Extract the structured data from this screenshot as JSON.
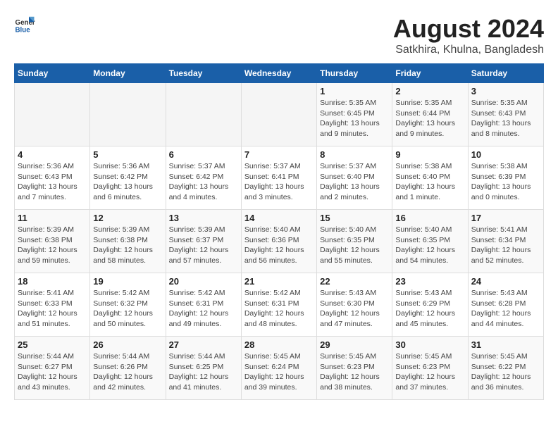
{
  "header": {
    "logo_general": "General",
    "logo_blue": "Blue",
    "title": "August 2024",
    "subtitle": "Satkhira, Khulna, Bangladesh"
  },
  "calendar": {
    "days_of_week": [
      "Sunday",
      "Monday",
      "Tuesday",
      "Wednesday",
      "Thursday",
      "Friday",
      "Saturday"
    ],
    "weeks": [
      [
        {
          "day": "",
          "info": ""
        },
        {
          "day": "",
          "info": ""
        },
        {
          "day": "",
          "info": ""
        },
        {
          "day": "",
          "info": ""
        },
        {
          "day": "1",
          "info": "Sunrise: 5:35 AM\nSunset: 6:45 PM\nDaylight: 13 hours\nand 9 minutes."
        },
        {
          "day": "2",
          "info": "Sunrise: 5:35 AM\nSunset: 6:44 PM\nDaylight: 13 hours\nand 9 minutes."
        },
        {
          "day": "3",
          "info": "Sunrise: 5:35 AM\nSunset: 6:43 PM\nDaylight: 13 hours\nand 8 minutes."
        }
      ],
      [
        {
          "day": "4",
          "info": "Sunrise: 5:36 AM\nSunset: 6:43 PM\nDaylight: 13 hours\nand 7 minutes."
        },
        {
          "day": "5",
          "info": "Sunrise: 5:36 AM\nSunset: 6:42 PM\nDaylight: 13 hours\nand 6 minutes."
        },
        {
          "day": "6",
          "info": "Sunrise: 5:37 AM\nSunset: 6:42 PM\nDaylight: 13 hours\nand 4 minutes."
        },
        {
          "day": "7",
          "info": "Sunrise: 5:37 AM\nSunset: 6:41 PM\nDaylight: 13 hours\nand 3 minutes."
        },
        {
          "day": "8",
          "info": "Sunrise: 5:37 AM\nSunset: 6:40 PM\nDaylight: 13 hours\nand 2 minutes."
        },
        {
          "day": "9",
          "info": "Sunrise: 5:38 AM\nSunset: 6:40 PM\nDaylight: 13 hours\nand 1 minute."
        },
        {
          "day": "10",
          "info": "Sunrise: 5:38 AM\nSunset: 6:39 PM\nDaylight: 13 hours\nand 0 minutes."
        }
      ],
      [
        {
          "day": "11",
          "info": "Sunrise: 5:39 AM\nSunset: 6:38 PM\nDaylight: 12 hours\nand 59 minutes."
        },
        {
          "day": "12",
          "info": "Sunrise: 5:39 AM\nSunset: 6:38 PM\nDaylight: 12 hours\nand 58 minutes."
        },
        {
          "day": "13",
          "info": "Sunrise: 5:39 AM\nSunset: 6:37 PM\nDaylight: 12 hours\nand 57 minutes."
        },
        {
          "day": "14",
          "info": "Sunrise: 5:40 AM\nSunset: 6:36 PM\nDaylight: 12 hours\nand 56 minutes."
        },
        {
          "day": "15",
          "info": "Sunrise: 5:40 AM\nSunset: 6:35 PM\nDaylight: 12 hours\nand 55 minutes."
        },
        {
          "day": "16",
          "info": "Sunrise: 5:40 AM\nSunset: 6:35 PM\nDaylight: 12 hours\nand 54 minutes."
        },
        {
          "day": "17",
          "info": "Sunrise: 5:41 AM\nSunset: 6:34 PM\nDaylight: 12 hours\nand 52 minutes."
        }
      ],
      [
        {
          "day": "18",
          "info": "Sunrise: 5:41 AM\nSunset: 6:33 PM\nDaylight: 12 hours\nand 51 minutes."
        },
        {
          "day": "19",
          "info": "Sunrise: 5:42 AM\nSunset: 6:32 PM\nDaylight: 12 hours\nand 50 minutes."
        },
        {
          "day": "20",
          "info": "Sunrise: 5:42 AM\nSunset: 6:31 PM\nDaylight: 12 hours\nand 49 minutes."
        },
        {
          "day": "21",
          "info": "Sunrise: 5:42 AM\nSunset: 6:31 PM\nDaylight: 12 hours\nand 48 minutes."
        },
        {
          "day": "22",
          "info": "Sunrise: 5:43 AM\nSunset: 6:30 PM\nDaylight: 12 hours\nand 47 minutes."
        },
        {
          "day": "23",
          "info": "Sunrise: 5:43 AM\nSunset: 6:29 PM\nDaylight: 12 hours\nand 45 minutes."
        },
        {
          "day": "24",
          "info": "Sunrise: 5:43 AM\nSunset: 6:28 PM\nDaylight: 12 hours\nand 44 minutes."
        }
      ],
      [
        {
          "day": "25",
          "info": "Sunrise: 5:44 AM\nSunset: 6:27 PM\nDaylight: 12 hours\nand 43 minutes."
        },
        {
          "day": "26",
          "info": "Sunrise: 5:44 AM\nSunset: 6:26 PM\nDaylight: 12 hours\nand 42 minutes."
        },
        {
          "day": "27",
          "info": "Sunrise: 5:44 AM\nSunset: 6:25 PM\nDaylight: 12 hours\nand 41 minutes."
        },
        {
          "day": "28",
          "info": "Sunrise: 5:45 AM\nSunset: 6:24 PM\nDaylight: 12 hours\nand 39 minutes."
        },
        {
          "day": "29",
          "info": "Sunrise: 5:45 AM\nSunset: 6:23 PM\nDaylight: 12 hours\nand 38 minutes."
        },
        {
          "day": "30",
          "info": "Sunrise: 5:45 AM\nSunset: 6:23 PM\nDaylight: 12 hours\nand 37 minutes."
        },
        {
          "day": "31",
          "info": "Sunrise: 5:45 AM\nSunset: 6:22 PM\nDaylight: 12 hours\nand 36 minutes."
        }
      ]
    ]
  }
}
